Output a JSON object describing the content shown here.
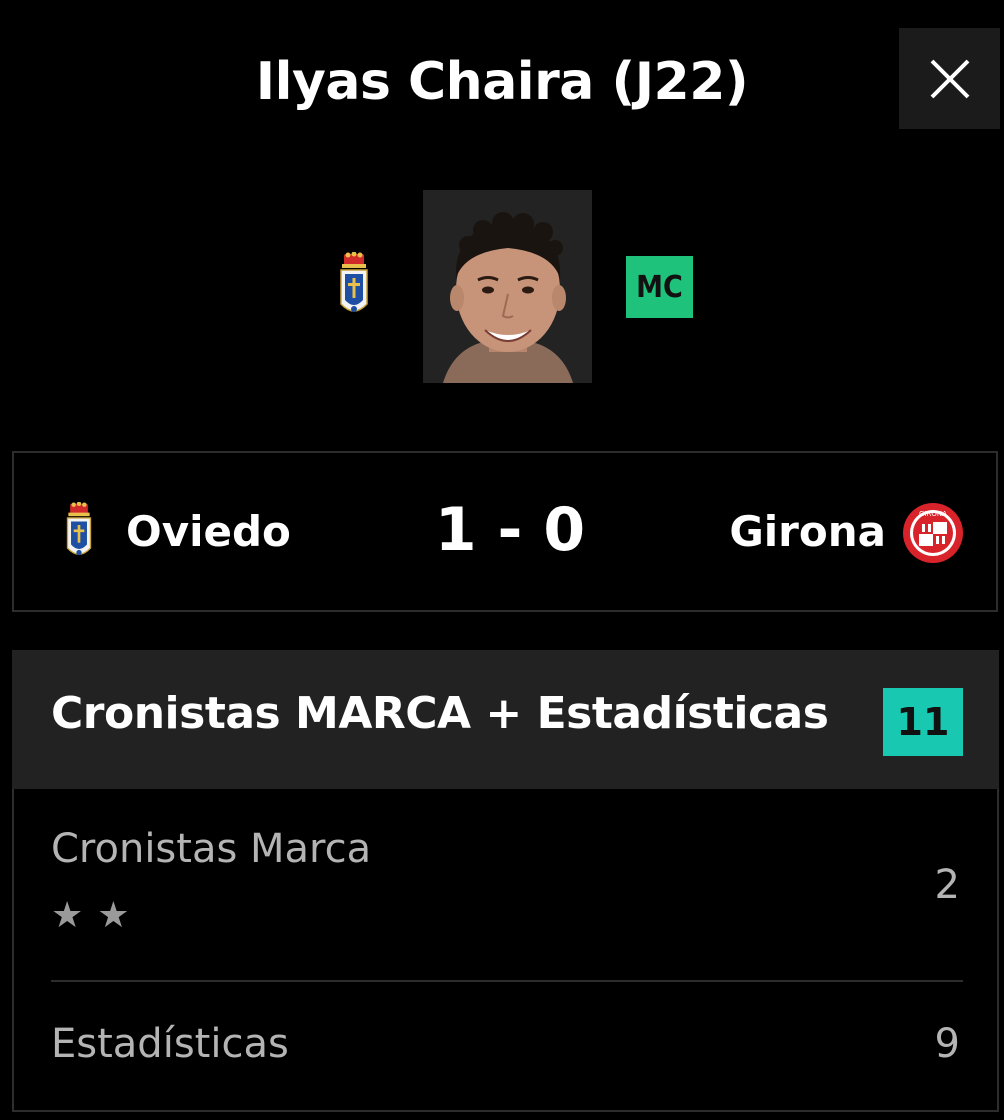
{
  "header": {
    "title": "Ilyas Chaira (J22)",
    "close_icon": "close-icon"
  },
  "player": {
    "photo_alt": "player-photo",
    "position": "MC",
    "position_color": "#1fc27a"
  },
  "match": {
    "home_team": "Oviedo",
    "score": "1 - 0",
    "away_team": "Girona"
  },
  "rating": {
    "header": "Cronistas MARCA + Estadísticas",
    "total": "11",
    "total_color": "#18c8b0",
    "rows": [
      {
        "label": "Cronistas Marca",
        "value": "2",
        "stars": 2
      },
      {
        "label": "Estadísticas",
        "value": "9"
      }
    ]
  }
}
